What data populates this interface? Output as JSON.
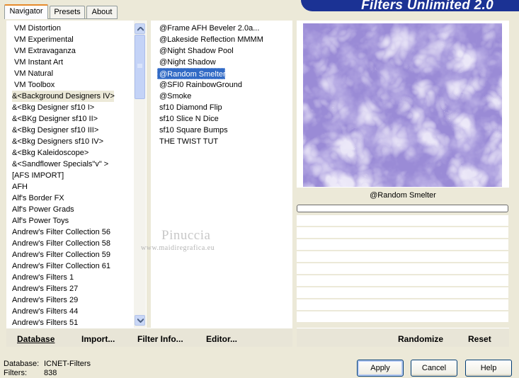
{
  "tabs": [
    {
      "label": "Navigator",
      "active": true
    },
    {
      "label": "Presets",
      "active": false
    },
    {
      "label": "About",
      "active": false
    }
  ],
  "banner": {
    "title": "Filters Unlimited 2.0"
  },
  "categories": [
    "VM Distortion",
    "VM Experimental",
    "VM Extravaganza",
    "VM Instant Art",
    "VM Natural",
    "VM Toolbox",
    "&<Background Designers IV>",
    "&<Bkg Designer sf10 I>",
    "&<BKg Designer sf10 II>",
    "&<Bkg Designer sf10 III>",
    "&<Bkg Designers sf10 IV>",
    "&<Bkg Kaleidoscope>",
    "&<Sandflower Specials\"v\" >",
    "[AFS IMPORT]",
    "AFH",
    "Alf's Border FX",
    "Alf's Power Grads",
    "Alf's Power Toys",
    "Andrew's Filter Collection 56",
    "Andrew's Filter Collection 58",
    "Andrew's Filter Collection 59",
    "Andrew's Filter Collection 61",
    "Andrew's Filters 1",
    "Andrew's Filters 27",
    "Andrew's Filters 29",
    "Andrew's Filters 44",
    "Andrew's Filters 51"
  ],
  "filters": [
    "@Frame AFH Beveler 2.0a...",
    "@Lakeside Reflection MMMM",
    "@Night Shadow Pool",
    "@Night Shadow",
    "@Random Smelter",
    "@SFI0 RainbowGround",
    "@Smoke",
    "sf10 Diamond Flip",
    "sf10 Slice N Dice",
    "sf10 Square Bumps",
    "THE TWIST TUT"
  ],
  "selected_category_index": 6,
  "selected_filter_index": 4,
  "preview": {
    "filter_name": "@Random Smelter"
  },
  "toolbar": {
    "database": "Database",
    "import": "Import...",
    "filter_info": "Filter Info...",
    "editor": "Editor...",
    "randomize": "Randomize",
    "reset": "Reset"
  },
  "status": {
    "database_label": "Database:",
    "database_value": "ICNET-Filters",
    "filters_label": "Filters:",
    "filters_value": "838"
  },
  "buttons": {
    "apply": "Apply",
    "cancel": "Cancel",
    "help": "Help"
  },
  "watermark": {
    "name": "Pinuccia",
    "url": "www.maidiregrafica.eu"
  },
  "colors": {
    "selection": "#316ac5",
    "banner": "#1b3294",
    "preview_base": "#8e7dd0"
  }
}
